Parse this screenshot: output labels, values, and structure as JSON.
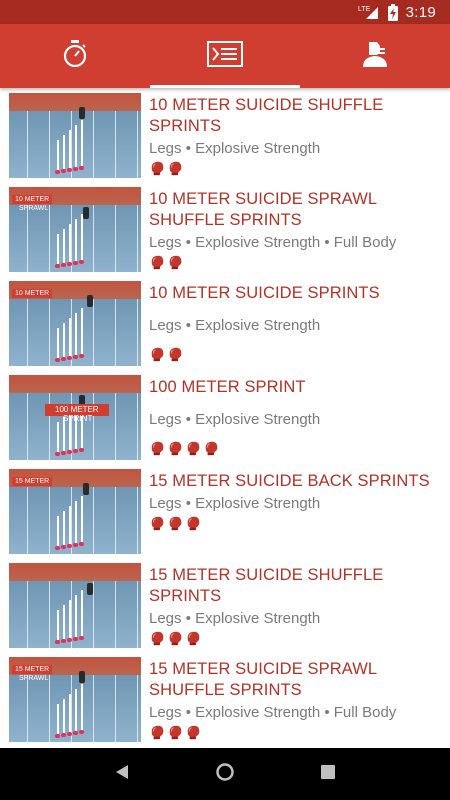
{
  "status_bar": {
    "network": "LTE",
    "time": "3:19",
    "icons": [
      "lte-signal-icon",
      "battery-charging-icon"
    ]
  },
  "tabs": [
    {
      "icon": "stopwatch-icon",
      "active": false
    },
    {
      "icon": "workout-list-icon",
      "active": true
    },
    {
      "icon": "profile-icon",
      "active": false
    }
  ],
  "exercises": [
    {
      "title": "10 METER SUICIDE SHUFFLE SPRINTS",
      "tags": "Legs • Explosive Strength",
      "difficulty": 2,
      "thumb_label": "",
      "thumb_sub": ""
    },
    {
      "title": "10 METER SUICIDE SPRAWL SHUFFLE SPRINTS",
      "tags": "Legs • Explosive Strength • Full Body",
      "difficulty": 2,
      "thumb_label": "10 METER",
      "thumb_sub": "SPRAWL"
    },
    {
      "title": "10 METER SUICIDE SPRINTS",
      "tags": "Legs • Explosive Strength",
      "difficulty": 2,
      "thumb_label": "10 METER",
      "thumb_sub": ""
    },
    {
      "title": "100 METER SPRINT",
      "tags": "Legs • Explosive Strength",
      "difficulty": 4,
      "thumb_label": "100 METER",
      "thumb_sub": "SPRINT"
    },
    {
      "title": "15 METER SUICIDE BACK SPRINTS",
      "tags": "Legs • Explosive Strength",
      "difficulty": 3,
      "thumb_label": "15 METER",
      "thumb_sub": ""
    },
    {
      "title": "15 METER SUICIDE SHUFFLE SPRINTS",
      "tags": "Legs • Explosive Strength",
      "difficulty": 3,
      "thumb_label": "",
      "thumb_sub": ""
    },
    {
      "title": "15 METER SUICIDE SPRAWL SHUFFLE SPRINTS",
      "tags": "Legs • Explosive Strength • Full Body",
      "difficulty": 3,
      "thumb_label": "15 METER",
      "thumb_sub": "SPRAWL"
    }
  ],
  "nav": [
    "back-icon",
    "home-icon",
    "recents-icon"
  ],
  "colors": {
    "primary": "#d03e31",
    "status": "#a52a1f",
    "title": "#b33226",
    "tags": "#7a7a7a"
  }
}
